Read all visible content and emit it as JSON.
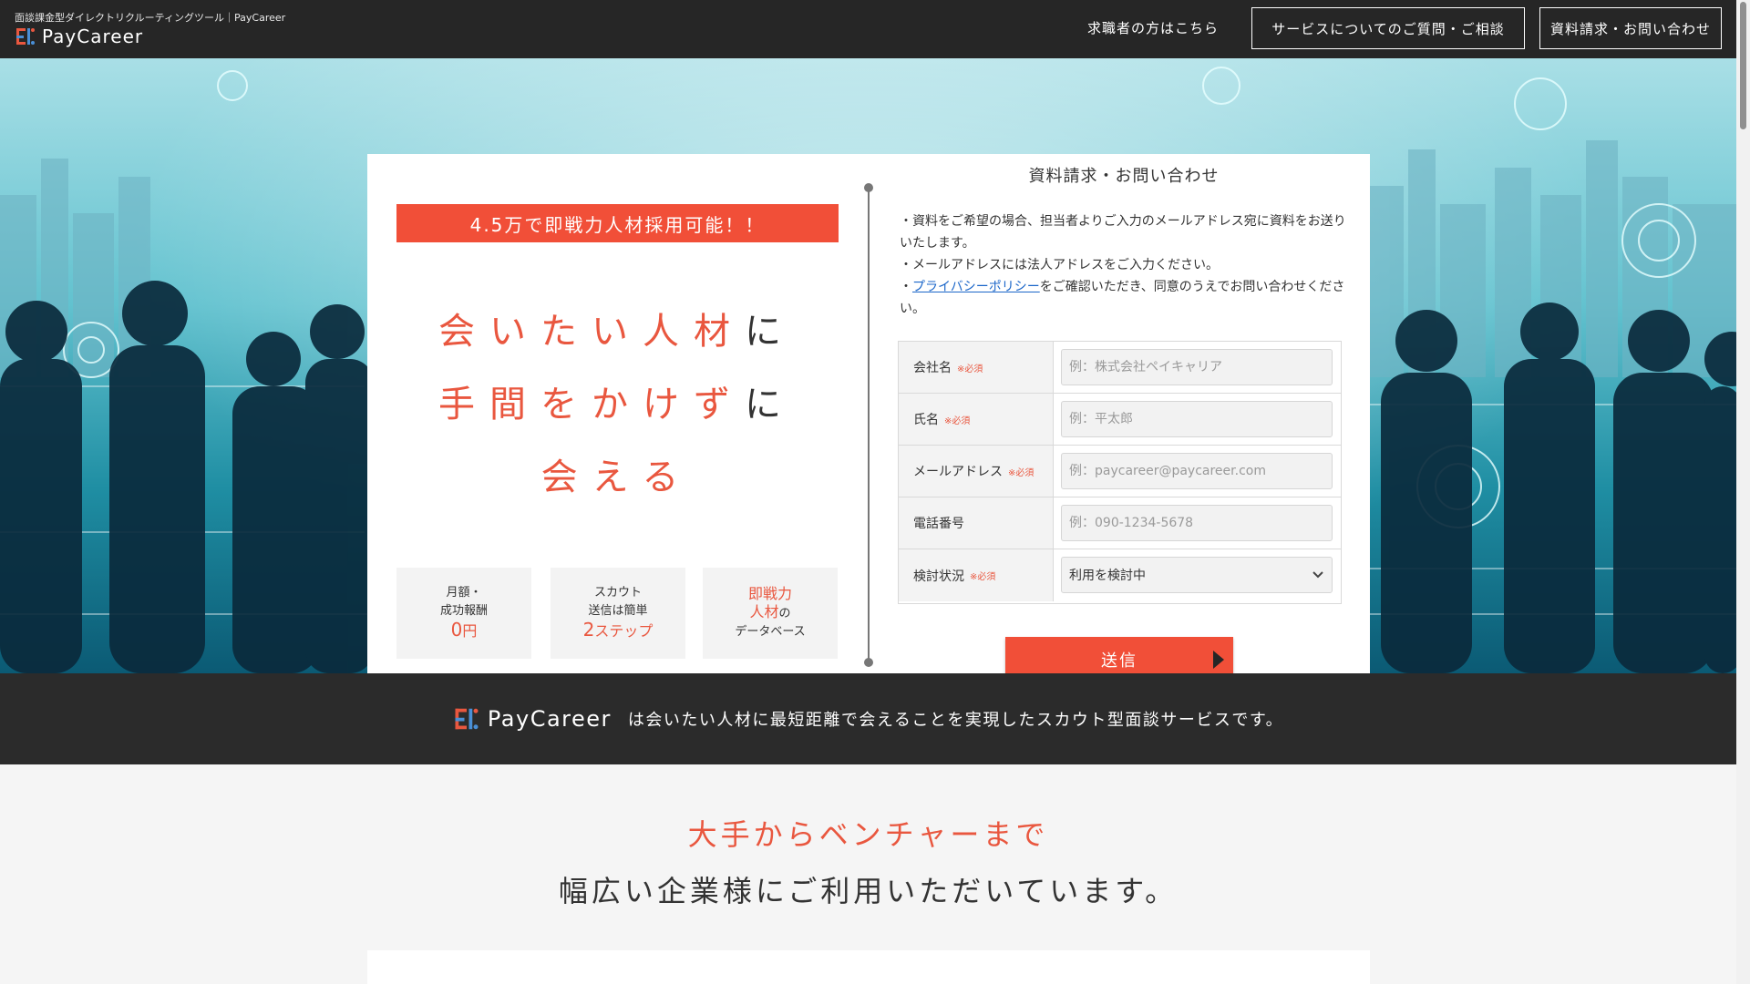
{
  "header": {
    "subtitle": "面談課金型ダイレクトリクルーティングツール｜PayCareer",
    "brand": "PayCareer",
    "nav": {
      "seeker_link": "求職者の方はこちら",
      "consult_button": "サービスについてのご質問・ご相談",
      "request_button": "資料請求・お問い合わせ"
    }
  },
  "hero": {
    "banner": "4.5万で即戦力人材採用可能！！",
    "catch": [
      {
        "highlight": "会いたい人材",
        "tail": "に"
      },
      {
        "highlight": "手間をかけず",
        "tail": "に"
      },
      {
        "highlight": "会える",
        "tail": ""
      }
    ],
    "features": [
      {
        "line1": "月額・",
        "line2": "成功報酬",
        "value": "0",
        "unit": "円"
      },
      {
        "line1": "スカウト",
        "line2": "送信は簡単",
        "value": "2",
        "unit": "ステップ"
      },
      {
        "line1": "即戦力",
        "line2": "人材",
        "suffix": "の",
        "line3": "データベース"
      }
    ]
  },
  "form": {
    "title": "資料請求・お問い合わせ",
    "notes": {
      "n1": "・資料をご希望の場合、担当者よりご入力のメールアドレス宛に資料をお送りいたします。",
      "n2": "・メールアドレスには法人アドレスをご入力ください。",
      "n3_prefix": "・",
      "n3_link": "プライバシーポリシー",
      "n3_suffix": "をご確認いただき、同意のうえでお問い合わせください。"
    },
    "required_mark": "※必須",
    "fields": {
      "company": {
        "label": "会社名",
        "placeholder": "例：株式会社ペイキャリア",
        "value": ""
      },
      "name": {
        "label": "氏名",
        "placeholder": "例：平太郎",
        "value": ""
      },
      "email": {
        "label": "メールアドレス",
        "placeholder": "例：paycareer@paycareer.com",
        "value": ""
      },
      "phone": {
        "label": "電話番号",
        "placeholder": "例：090-1234-5678",
        "value": ""
      },
      "status": {
        "label": "検討状況",
        "selected": "利用を検討中"
      }
    },
    "submit": "送信"
  },
  "band": {
    "brand": "PayCareer",
    "text": "は会いたい人材に最短距離で会えることを実現したスカウト型面談サービスです。"
  },
  "clients": {
    "heading_accent": "大手からベンチャーまで",
    "heading_main": "幅広い企業様にご利用いただいています。"
  },
  "colors": {
    "accent": "#f14f38",
    "header_bg": "#262626",
    "band_bg": "#2b2b2b",
    "link": "#1b66c9"
  },
  "icons": {
    "logo": "paycareer-logo-icon",
    "select_arrow": "chevron-down-icon",
    "submit_arrow": "triangle-right-icon"
  }
}
